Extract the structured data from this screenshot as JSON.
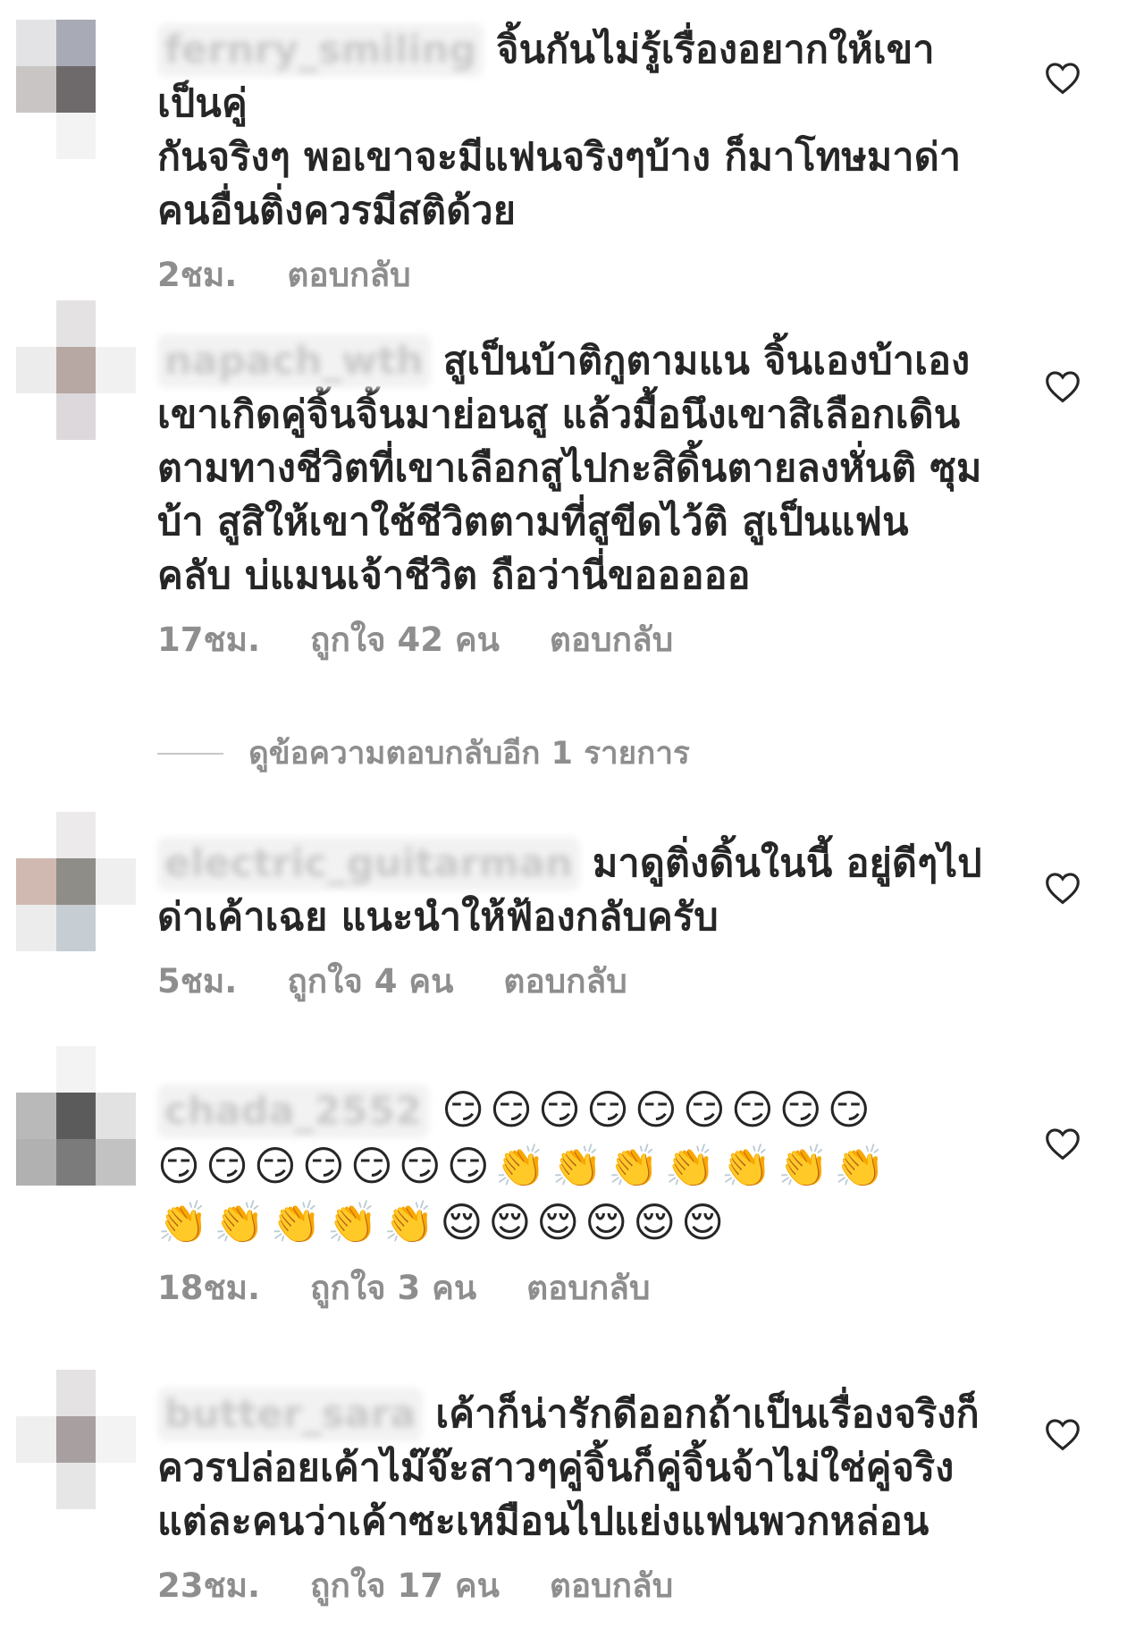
{
  "colors": {
    "text": "#262626",
    "meta": "#8e8e8e",
    "heart": "#262626"
  },
  "comments": [
    {
      "username": "fernry_smiling",
      "text": "จิ้นกันไม่รู้เรื่องอยากให้เขาเป็นคู่ กันจริงๆ พอเขาจะมีแฟนจริงๆบ้าง ก็มาโทษมาด่า คนอื่นติ่งควรมีสติด้วย",
      "lines": [
        "จิ้นกันไม่รู้เรื่องอยากให้เขาเป็นคู่",
        "กันจริงๆ พอเขาจะมีแฟนจริงๆบ้าง ก็มาโทษมาด่า",
        "คนอื่นติ่งควรมีสติด้วย"
      ],
      "time": "2ชม.",
      "likes": "",
      "reply": "ตอบกลับ"
    },
    {
      "username": "napach_wth",
      "lines": [
        "สูเป็นบ้าติกูตามแน จิ้นเองบ้าเอง",
        "เขาเกิดคู่จิ้นจิ้นมาย่อนสู แล้วมื้อนึงเขาสิเลือกเดิน",
        "ตามทางชีวิตที่เขาเลือกสูไปกะสิดิ้นตายลงหั่นติ ซุม",
        "บ้า สูสิให้เขาใช้ชีวิตตามที่สูขีดไว้ติ  สูเป็นแฟน",
        "คลับ บ่แมนเจ้าชีวิต ถือว่านี่ขอออออ"
      ],
      "time": "17ชม.",
      "likes": "ถูกใจ 42 คน",
      "reply": "ตอบกลับ"
    },
    {
      "username": "electric_guitarman",
      "lines": [
        "มาดูติ่งดิ้นในนี้ อยู่ดีๆไป",
        "ด่าเค้าเฉย แนะนำให้ฟ้องกลับครับ"
      ],
      "time": "5ชม.",
      "likes": "ถูกใจ 4 คน",
      "reply": "ตอบกลับ"
    },
    {
      "username": "chada_2552",
      "emoji_rows": [
        "😏😏😏😏😏😏😏😏😏",
        "😏😏😏😏😏😏😏👏👏👏👏👏👏👏",
        "👏👏👏👏👏😌😌😌😌😌😌"
      ],
      "time": "18ชม.",
      "likes": "ถูกใจ 3 คน",
      "reply": "ตอบกลับ"
    },
    {
      "username": "butter_sara",
      "lines": [
        "เค้าก็น่ารักดีออกถ้าเป็นเรื่องจริงก็",
        "ควรปล่อยเค้าไม๊จ๊ะสาวๆคู่จิ้นก็คู่จิ้นจ้าไม่ใช่คู่จริง",
        "แต่ละคนว่าเค้าซะเหมือนไปแย่งแฟนพวกหล่อน"
      ],
      "time": "23ชม.",
      "likes": "ถูกใจ 17 คน",
      "reply": "ตอบกลับ"
    }
  ],
  "view_replies": "ดูข้อความตอบกลับอีก 1 รายการ",
  "icons": {
    "heart": "heart-outline-icon"
  }
}
